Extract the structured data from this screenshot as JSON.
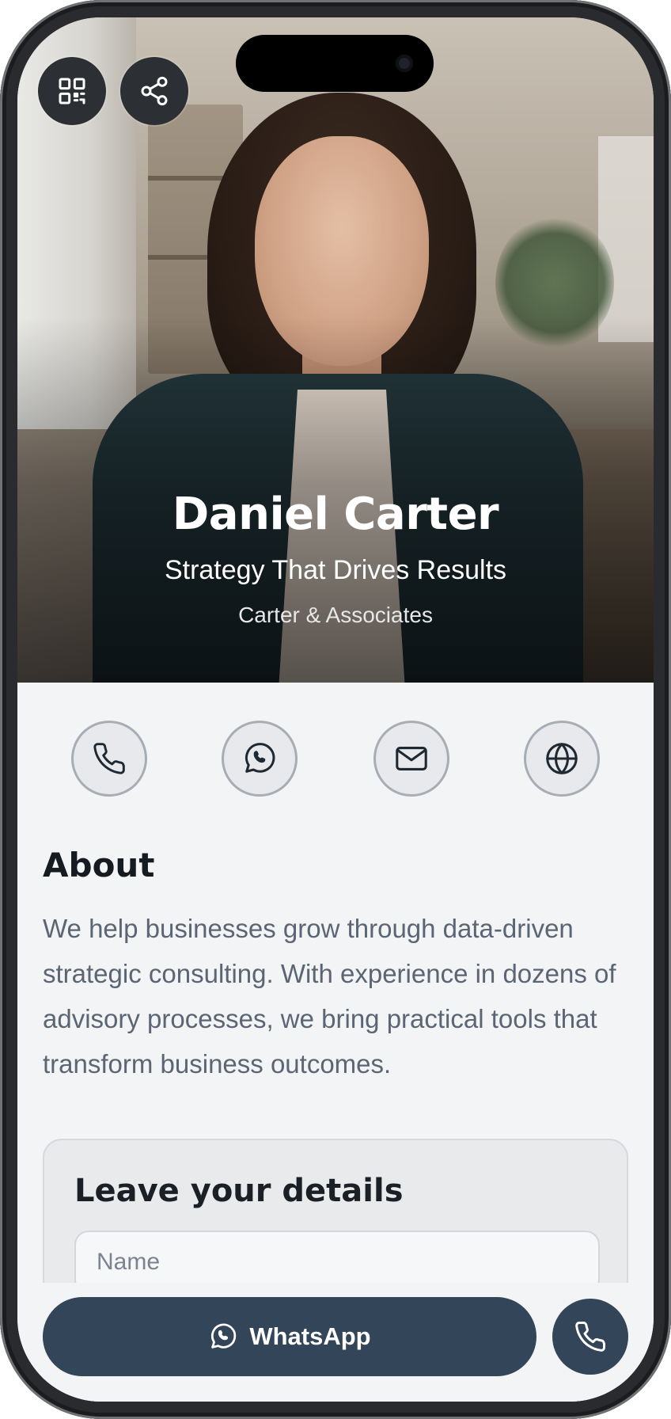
{
  "profile": {
    "name": "Daniel Carter",
    "tagline": "Strategy That Drives Results",
    "company": "Carter & Associates"
  },
  "hero_actions": [
    {
      "icon": "qr-code-icon"
    },
    {
      "icon": "share-icon"
    }
  ],
  "contact_actions": [
    {
      "icon": "phone-icon"
    },
    {
      "icon": "whatsapp-icon"
    },
    {
      "icon": "mail-icon"
    },
    {
      "icon": "globe-icon"
    }
  ],
  "about": {
    "title": "About",
    "text": "We help businesses grow through data-driven strategic consulting. With experience in dozens of advisory processes, we bring practical tools that transform business outcomes."
  },
  "form": {
    "title": "Leave your details",
    "name_placeholder": "Name"
  },
  "bottom_bar": {
    "whatsapp_label": "WhatsApp"
  },
  "colors": {
    "accent": "#334558",
    "background": "#f2f4f6",
    "text_primary": "#161b22",
    "text_secondary": "#5b6573"
  }
}
